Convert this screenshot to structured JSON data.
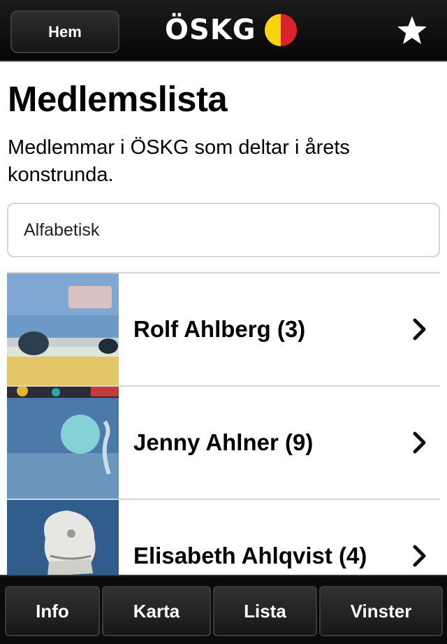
{
  "header": {
    "home_label": "Hem",
    "logo_text": "ÖSKG",
    "logo_colors": [
      "#f6d20f",
      "#d8242b"
    ],
    "favorite_icon": "star-icon"
  },
  "main": {
    "title": "Medlemslista",
    "intro": "Medlemmar i ÖSKG som deltar i årets konstrunda.",
    "sort_selected": "Alfabetisk",
    "members": [
      {
        "name": "Rolf Ahlberg (3)",
        "thumb_icon": "artwork-thumbnail"
      },
      {
        "name": "Jenny Ahlner (9)",
        "thumb_icon": "artwork-thumbnail"
      },
      {
        "name": "Elisabeth Ahlqvist (4)",
        "thumb_icon": "artwork-thumbnail"
      }
    ]
  },
  "tabbar": {
    "tabs": [
      {
        "label": "Info"
      },
      {
        "label": "Karta"
      },
      {
        "label": "Lista"
      },
      {
        "label": "Vinster"
      }
    ]
  }
}
